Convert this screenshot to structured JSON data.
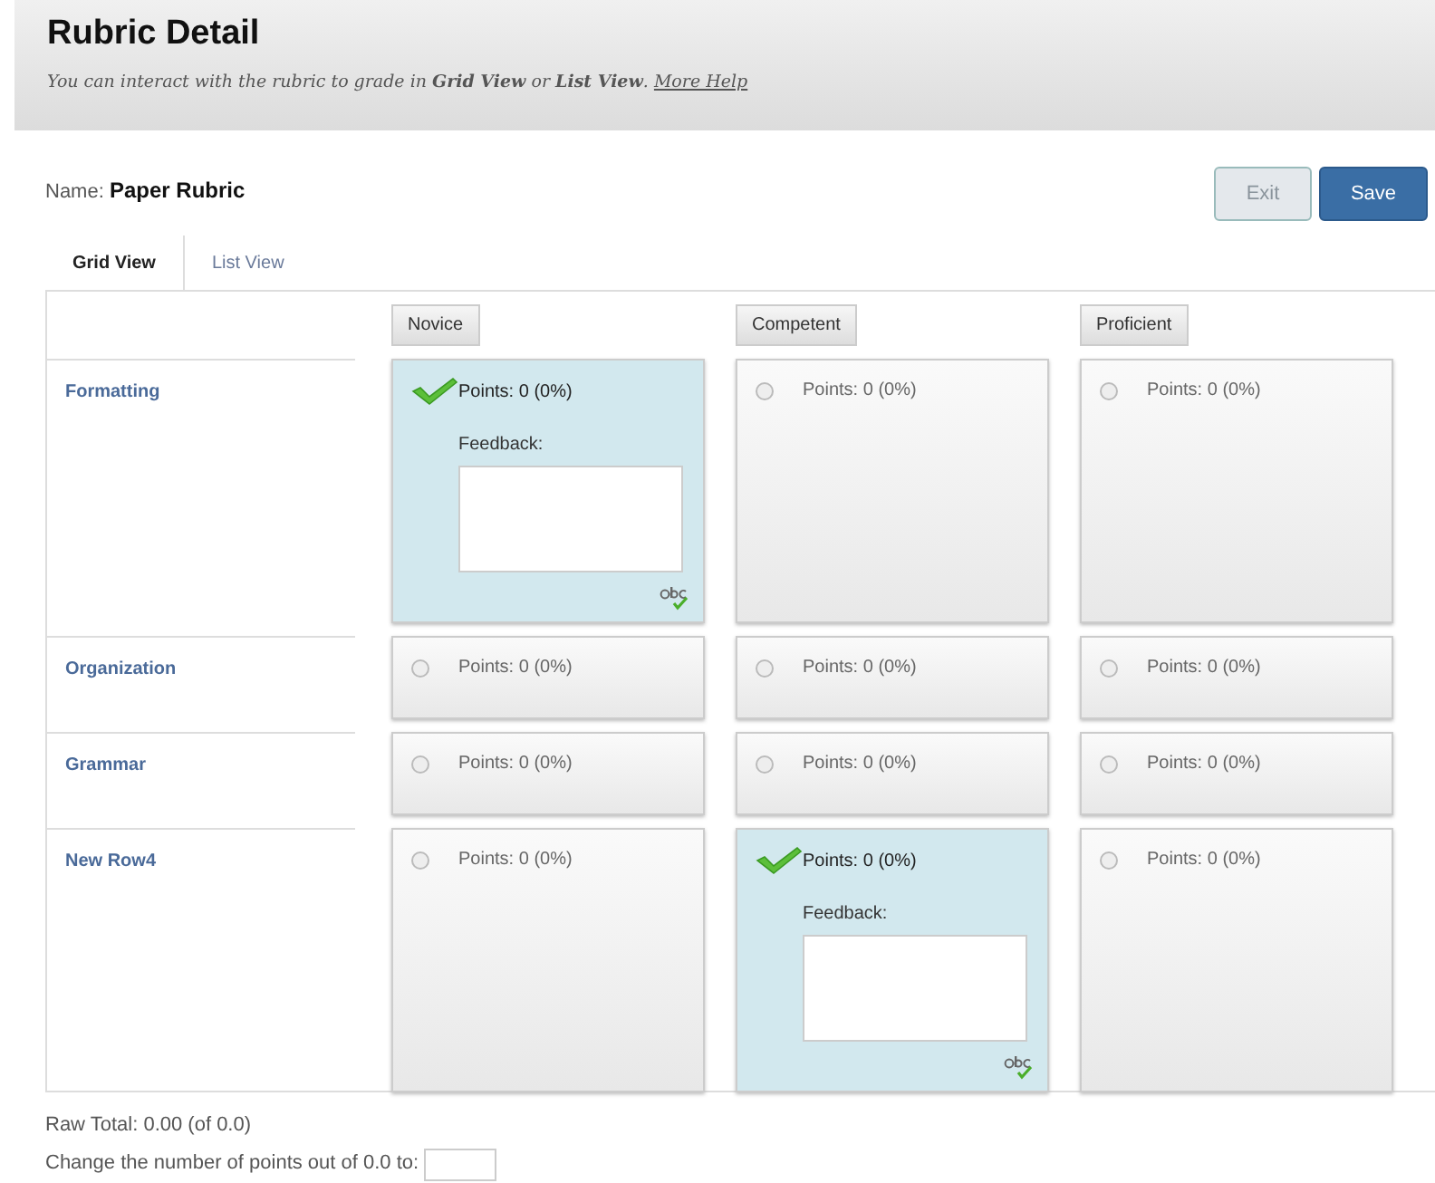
{
  "header": {
    "title": "Rubric Detail",
    "subtitle": "You can interact with the rubric to grade in **Grid View** or **List View**. ",
    "help_link": "More Help"
  },
  "name_label": "Name:",
  "name_value": "Paper Rubric",
  "buttons": [
    {
      "label": "Exit",
      "disabled": true,
      "kind": "secondary"
    },
    {
      "label": "Save",
      "kind": "primary"
    }
  ],
  "tabs": [
    {
      "label": "Grid View",
      "selected": true
    },
    {
      "label": "List View",
      "selected": false
    }
  ],
  "columns": [
    "Novice",
    "Competent",
    "Proficient"
  ],
  "rows": [
    {
      "label": "Formatting",
      "cells": [
        {
          "points": "Points: 0 (0%)",
          "selected": true,
          "feedback_label": "Feedback:"
        },
        {
          "points": "Points: 0 (0%)",
          "selected": false
        },
        {
          "points": "Points: 0 (0%)",
          "selected": false
        }
      ]
    },
    {
      "label": "Organization",
      "cells": [
        {
          "points": "Points: 0 (0%)",
          "selected": false
        },
        {
          "points": "Points: 0 (0%)",
          "selected": false
        },
        {
          "points": "Points: 0 (0%)",
          "selected": false
        }
      ]
    },
    {
      "label": "Grammar",
      "cells": [
        {
          "points": "Points: 0 (0%)",
          "selected": false
        },
        {
          "points": "Points: 0 (0%)",
          "selected": false
        },
        {
          "points": "Points: 0 (0%)",
          "selected": false
        }
      ]
    },
    {
      "label": "New Row4",
      "cells": [
        {
          "points": "Points: 0 (0%)",
          "selected": false
        },
        {
          "points": "Points: 0 (0%)",
          "selected": true,
          "feedback_label": "Feedback:"
        },
        {
          "points": "Points: 0 (0%)",
          "selected": false
        }
      ]
    }
  ],
  "raw_total": "Raw Total: 0.00 (of 0.0)",
  "change_points_label": "Change the number of points out of 0.0 to:"
}
